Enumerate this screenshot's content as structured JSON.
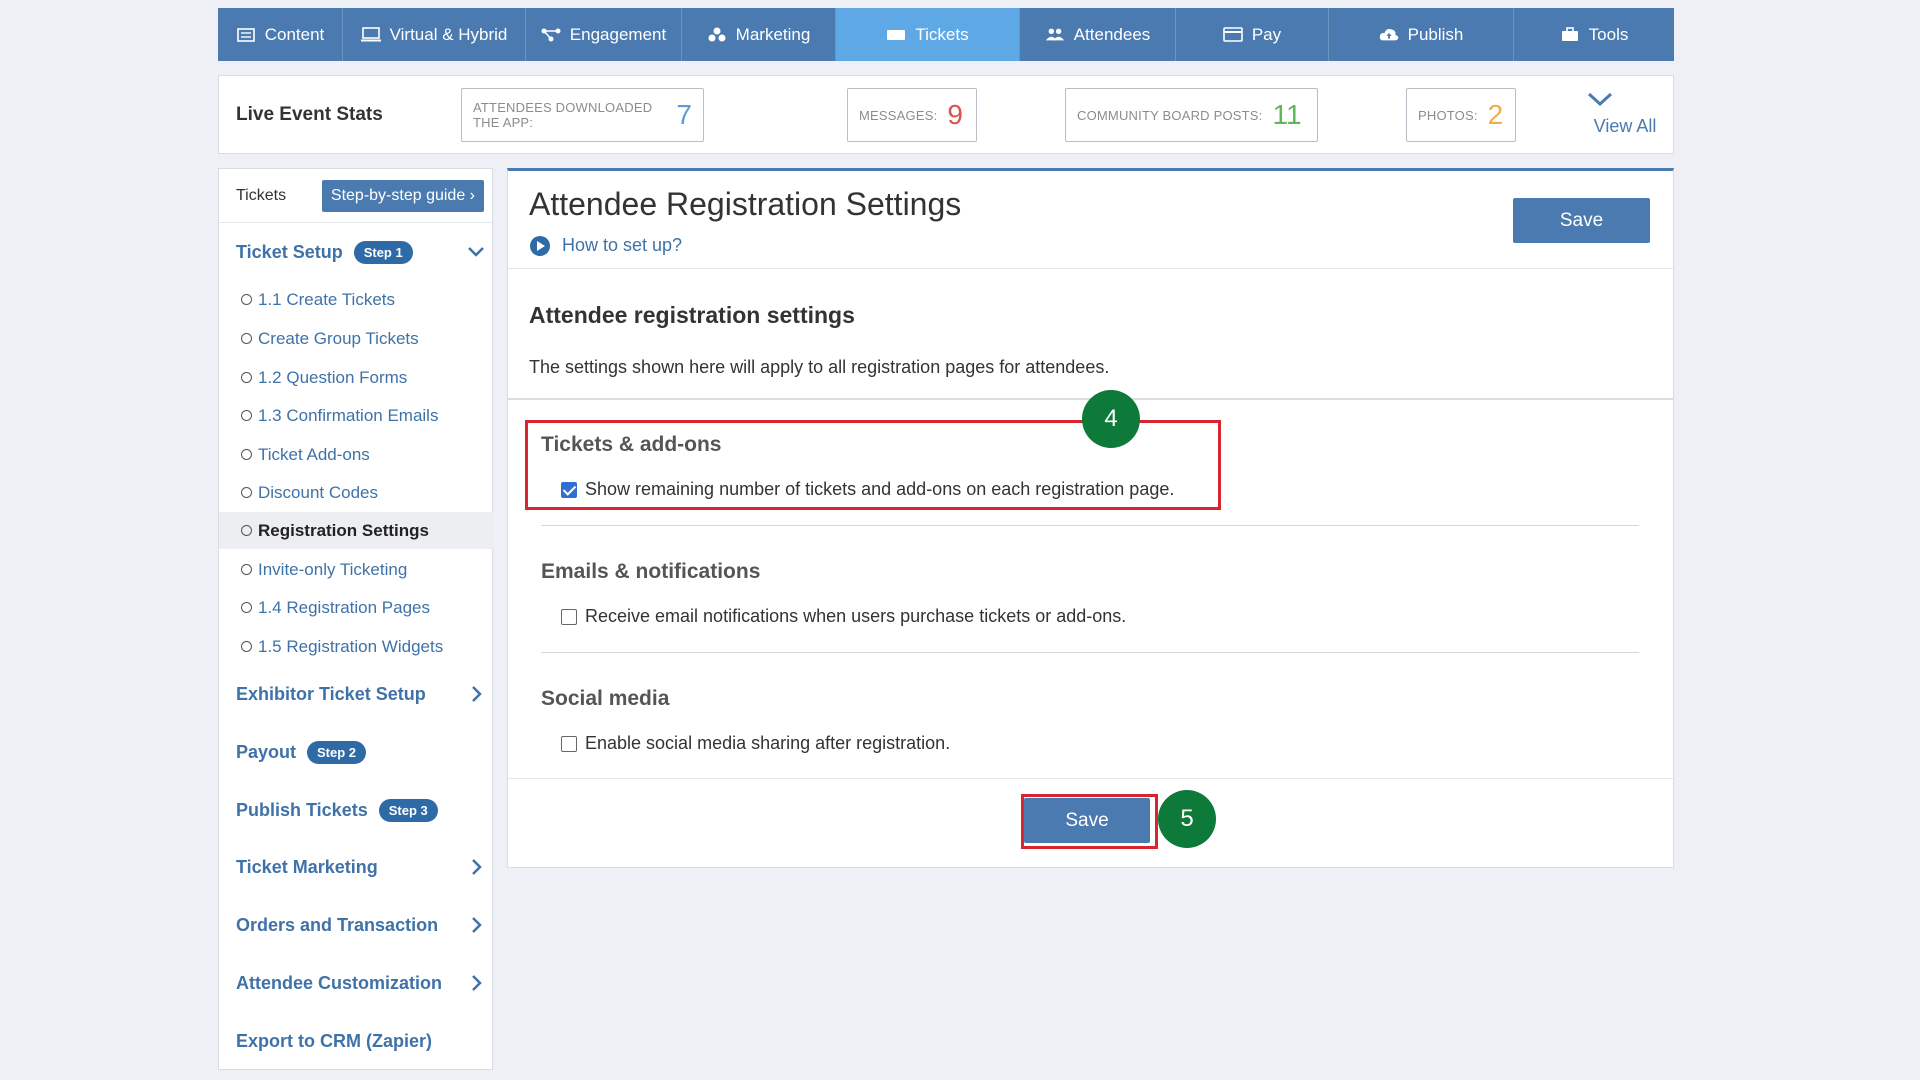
{
  "nav": {
    "tabs": [
      {
        "label": "Content",
        "icon": "content-icon"
      },
      {
        "label": "Virtual & Hybrid",
        "icon": "monitor-icon"
      },
      {
        "label": "Engagement",
        "icon": "engagement-icon"
      },
      {
        "label": "Marketing",
        "icon": "marketing-icon"
      },
      {
        "label": "Tickets",
        "icon": "ticket-icon",
        "active": true
      },
      {
        "label": "Attendees",
        "icon": "attendees-icon"
      },
      {
        "label": "Pay",
        "icon": "card-icon"
      },
      {
        "label": "Publish",
        "icon": "cloud-upload-icon"
      },
      {
        "label": "Tools",
        "icon": "toolbox-icon"
      }
    ]
  },
  "stats": {
    "title": "Live Event Stats",
    "items": [
      {
        "label": "ATTENDEES DOWNLOADED THE APP:",
        "value": "7",
        "color": "#5b9bd5"
      },
      {
        "label": "MESSAGES:",
        "value": "9",
        "color": "#d9534f"
      },
      {
        "label": "COMMUNITY BOARD POSTS:",
        "value": "11",
        "color": "#5cb85c"
      },
      {
        "label": "PHOTOS:",
        "value": "2",
        "color": "#f0ad4e"
      }
    ],
    "view_all": "View All"
  },
  "sidebar": {
    "header": "Tickets",
    "guide_button": "Step-by-step guide",
    "ticket_setup": {
      "label": "Ticket Setup",
      "badge": "Step 1"
    },
    "sub_items": [
      "1.1 Create Tickets",
      "Create Group Tickets",
      "1.2 Question Forms",
      "1.3 Confirmation Emails",
      "Ticket Add-ons",
      "Discount Codes",
      "Registration Settings",
      "Invite-only Ticketing",
      "1.4 Registration Pages",
      "1.5 Registration Widgets"
    ],
    "exhibitor": "Exhibitor Ticket Setup",
    "payout": {
      "label": "Payout",
      "badge": "Step 2"
    },
    "publish": {
      "label": "Publish Tickets",
      "badge": "Step 3"
    },
    "marketing": "Ticket Marketing",
    "orders": "Orders and Transaction",
    "customization": "Attendee Customization",
    "crm": "Export to CRM (Zapier)"
  },
  "main": {
    "title": "Attendee Registration Settings",
    "how_to": "How to set up?",
    "save_top": "Save",
    "section_title": "Attendee registration settings",
    "section_desc": "The settings shown here will apply to all registration pages for attendees.",
    "groups": [
      {
        "title": "Tickets & add-ons",
        "option": "Show remaining number of tickets and add-ons on each registration page.",
        "checked": true
      },
      {
        "title": "Emails & notifications",
        "option": "Receive email notifications when users purchase tickets or add-ons.",
        "checked": false
      },
      {
        "title": "Social media",
        "option": "Enable social media sharing after registration.",
        "checked": false
      }
    ],
    "save_bottom": "Save"
  },
  "annotations": {
    "step4": "4",
    "step5": "5"
  }
}
